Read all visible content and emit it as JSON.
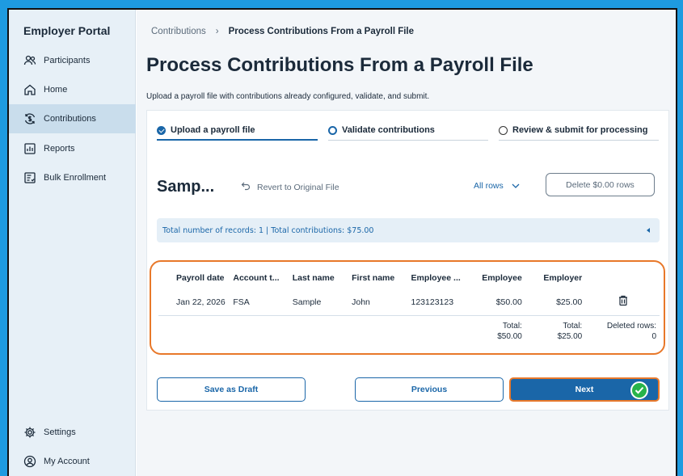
{
  "sidebar": {
    "brand": "Employer Portal",
    "items": [
      {
        "label": "Participants",
        "icon": "people-icon"
      },
      {
        "label": "Home",
        "icon": "home-icon"
      },
      {
        "label": "Contributions",
        "icon": "dollar-cycle-icon",
        "active": true
      },
      {
        "label": "Reports",
        "icon": "report-icon"
      },
      {
        "label": "Bulk Enrollment",
        "icon": "bulk-enrollment-icon"
      }
    ],
    "bottom_items": [
      {
        "label": "Settings",
        "icon": "gear-icon"
      },
      {
        "label": "My Account",
        "icon": "account-icon"
      }
    ]
  },
  "breadcrumb": {
    "parent": "Contributions",
    "separator": "›",
    "current": "Process Contributions From a Payroll File"
  },
  "page": {
    "title": "Process Contributions From a Payroll File",
    "subtitle": "Upload a payroll file with contributions already configured, validate, and submit."
  },
  "steps": [
    {
      "label": "Upload a payroll file",
      "state": "done"
    },
    {
      "label": "Validate contributions",
      "state": "current"
    },
    {
      "label": "Review & submit for processing",
      "state": "pending"
    }
  ],
  "file": {
    "name": "Samp...",
    "revert_label": "Revert to Original File",
    "rows_filter": "All rows",
    "delete_label": "Delete $0.00 rows",
    "summary": "Total number of records: 1 | Total contributions: $75.00"
  },
  "table": {
    "headers": [
      "Payroll date",
      "Account t...",
      "Last name",
      "First name",
      "Employee ...",
      "Employee",
      "Employer",
      ""
    ],
    "rows": [
      [
        "Jan 22, 2026",
        "FSA",
        "Sample",
        "John",
        "123123123",
        "$50.00",
        "$25.00"
      ]
    ],
    "totals": {
      "employee_label": "Total:",
      "employee_value": "$50.00",
      "employer_label": "Total:",
      "employer_value": "$25.00",
      "deleted_label": "Deleted rows:",
      "deleted_value": "0"
    }
  },
  "actions": {
    "save_draft": "Save as Draft",
    "previous": "Previous",
    "next": "Next"
  },
  "colors": {
    "accent": "#1a66a8",
    "highlight": "#e8782a",
    "success": "#27b34a",
    "sidebar_bg": "#e7f0f7"
  }
}
